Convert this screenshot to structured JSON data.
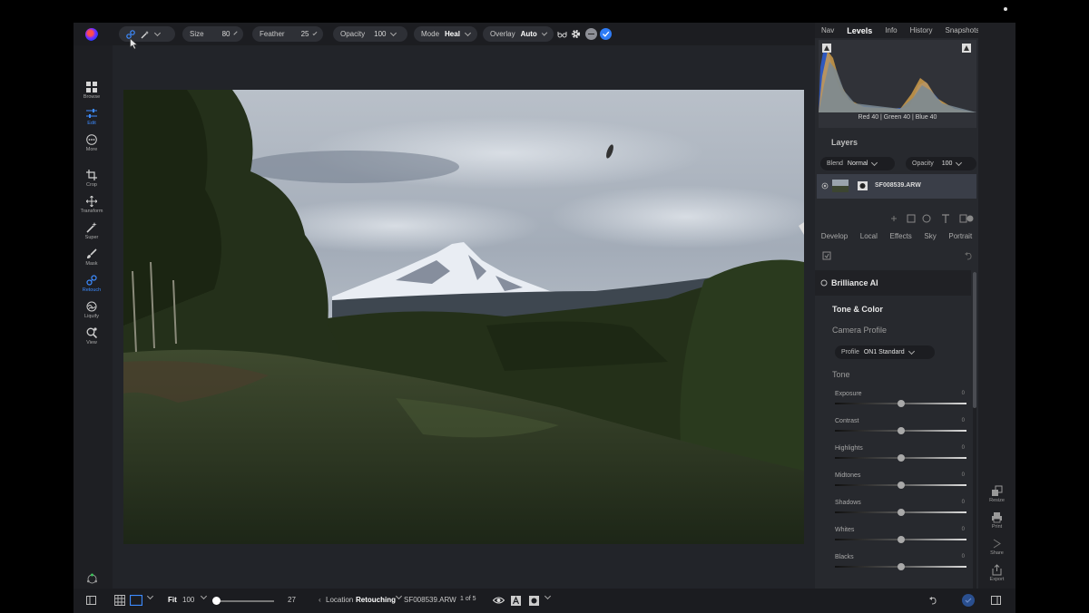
{
  "toolbar": {
    "size_label": "Size",
    "size_value": "80",
    "feather_label": "Feather",
    "feather_value": "25",
    "opacity_label": "Opacity",
    "opacity_value": "100",
    "mode_label": "Mode",
    "mode_value": "Heal",
    "overlay_label": "Overlay",
    "overlay_value": "Auto"
  },
  "left_tools": [
    {
      "label": "Browse",
      "icon": "grid-icon"
    },
    {
      "label": "Edit",
      "icon": "sliders-icon"
    },
    {
      "label": "More",
      "icon": "more-icon"
    },
    {
      "label": "Crop",
      "icon": "crop-icon"
    },
    {
      "label": "Transform",
      "icon": "move-icon"
    },
    {
      "label": "Super",
      "icon": "wand-icon"
    },
    {
      "label": "Mask",
      "icon": "brush-icon"
    },
    {
      "label": "Retouch",
      "icon": "bandage-icon"
    },
    {
      "label": "Liquify",
      "icon": "liquify-icon"
    },
    {
      "label": "View",
      "icon": "zoom-icon"
    }
  ],
  "panel_tabs": [
    "Nav",
    "Levels",
    "Info",
    "History",
    "Snapshots"
  ],
  "active_panel_tab": "Levels",
  "histogram": {
    "readout": "Red 40 | Green 40 | Blue 40"
  },
  "layers": {
    "title": "Layers",
    "blend_label": "Blend",
    "blend_value": "Normal",
    "opacity_label": "Opacity",
    "opacity_value": "100",
    "layer_name": "SF008539.ARW"
  },
  "sub_tabs": [
    "Develop",
    "Local",
    "Effects",
    "Sky",
    "Portrait"
  ],
  "develop": {
    "brilliance": "Brilliance AI",
    "tone_color": "Tone & Color",
    "camera_profile": "Camera Profile",
    "profile_label": "Profile",
    "profile_value": "ON1 Standard",
    "tone": "Tone"
  },
  "sliders": [
    {
      "name": "Exposure",
      "value": "0",
      "level": 0.5
    },
    {
      "name": "Contrast",
      "value": "0",
      "level": 0.5
    },
    {
      "name": "Highlights",
      "value": "0",
      "level": 0.5
    },
    {
      "name": "Midtones",
      "value": "0",
      "level": 0.5
    },
    {
      "name": "Shadows",
      "value": "0",
      "level": 0.5
    },
    {
      "name": "Whites",
      "value": "0",
      "level": 0.5
    },
    {
      "name": "Blacks",
      "value": "0",
      "level": 0.5
    }
  ],
  "share": [
    "Resize",
    "Print",
    "Share",
    "Export"
  ],
  "bottom": {
    "fit": "Fit",
    "zoom": "100",
    "slider_value": "27",
    "location_label": "Location",
    "location_value": "Retouching",
    "filename": "SF008539.ARW",
    "page": "1 of 5",
    "zoom_level": 0.0
  },
  "colors": {
    "accent": "#3d8bff",
    "panel": "#27292e",
    "background": "#222429"
  }
}
